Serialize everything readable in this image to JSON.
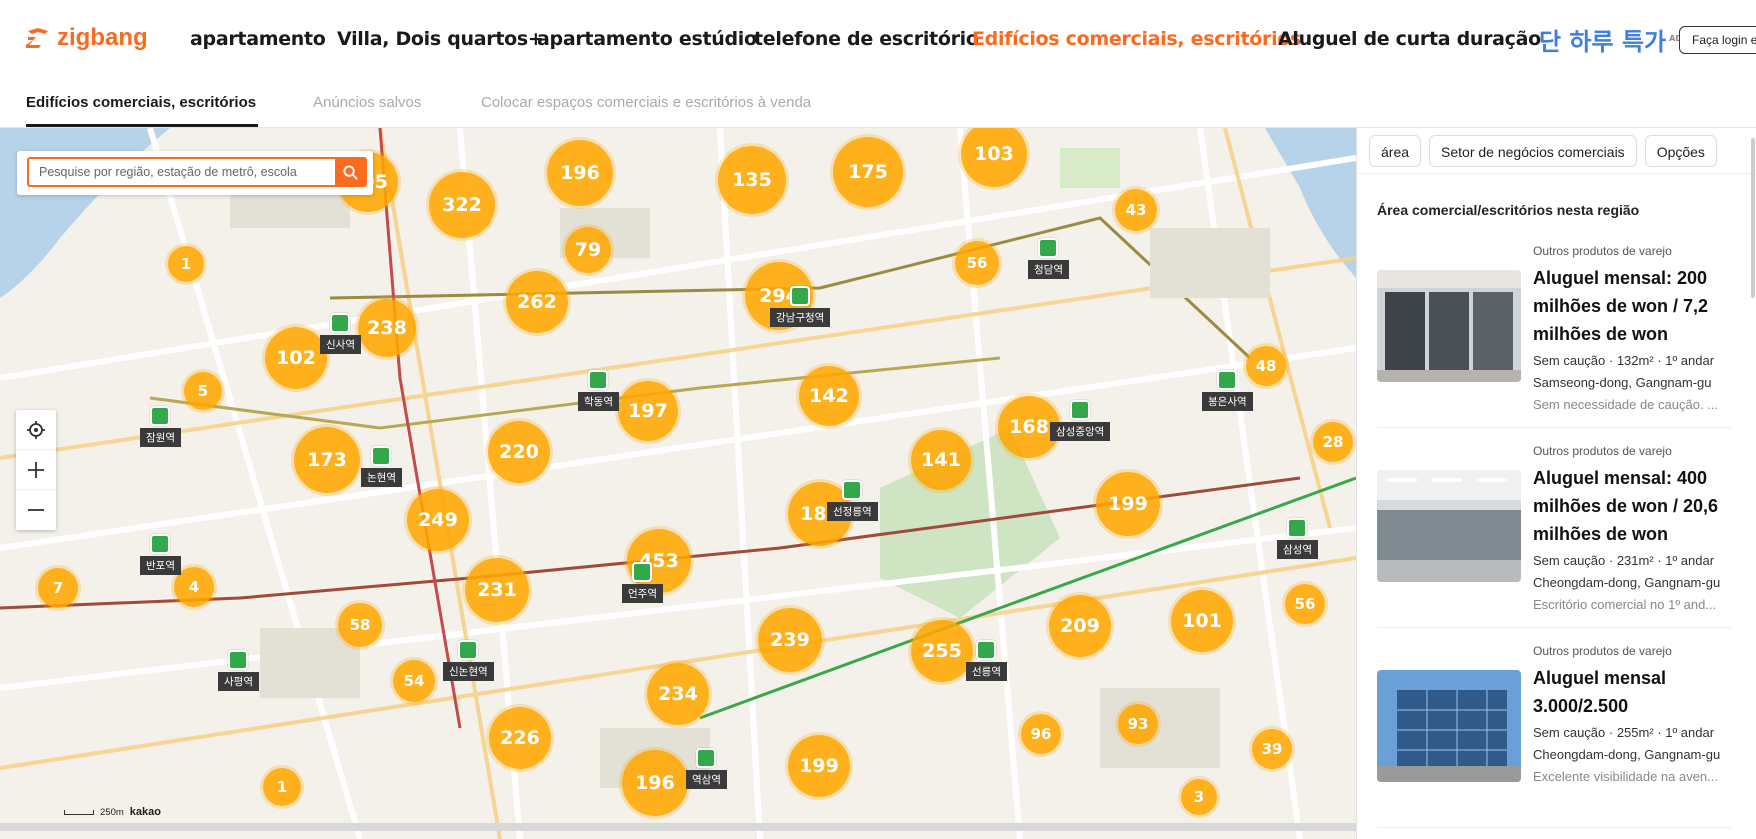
{
  "brand": {
    "name": "zigbang",
    "color": "#fa6b20"
  },
  "nav": {
    "items": [
      {
        "label": "apartamento",
        "active": false
      },
      {
        "label": "Villa, Dois quartos+",
        "active": false
      },
      {
        "label": "apartamento estúdio",
        "active": false
      },
      {
        "label": "telefone de escritório",
        "active": false
      },
      {
        "label": "Edifícios comerciais, escritórios",
        "active": true
      },
      {
        "label": "Aluguel de curta duração",
        "active": false
      }
    ],
    "promo": "단 하루 특가",
    "promo_badge": "AD",
    "login": "Faça login e"
  },
  "subtabs": [
    {
      "label": "Edifícios comerciais, escritórios",
      "active": true
    },
    {
      "label": "Anúncios salvos",
      "active": false
    },
    {
      "label": "Colocar espaços comerciais e escritórios à venda",
      "active": false
    }
  ],
  "search": {
    "placeholder": "Pesquise por região, estação de metrô, escola"
  },
  "map": {
    "icons": {
      "locate": "locate-icon",
      "zoom_in": "plus-icon",
      "zoom_out": "minus-icon"
    },
    "scale_label": "250m",
    "provider": "kakao",
    "clusters": [
      "305",
      "322",
      "196",
      "135",
      "175",
      "103",
      "43",
      "79",
      "56",
      "1",
      "262",
      "294",
      "238",
      "102",
      "5",
      "197",
      "142",
      "48",
      "168",
      "173",
      "220",
      "141",
      "28",
      "249",
      "182",
      "199",
      "453",
      "7",
      "4",
      "231",
      "58",
      "239",
      "255",
      "209",
      "101",
      "56",
      "54",
      "234",
      "226",
      "96",
      "93",
      "39",
      "1",
      "196",
      "199",
      "3"
    ],
    "stations": [
      "신사역",
      "강남구청역",
      "청담역",
      "학동역",
      "봉은사역",
      "잠원역",
      "논현역",
      "삼성중앙역",
      "선정릉역",
      "반포역",
      "언주역",
      "삼성역",
      "신논현역",
      "사평역",
      "선릉역",
      "역삼역"
    ]
  },
  "panel": {
    "filters": [
      "área",
      "Setor de negócios comerciais",
      "Opções"
    ],
    "title": "Área comercial/escritórios nesta região",
    "listings": [
      {
        "category": "Outros produtos de varejo",
        "title": "Aluguel mensal: 200 milhões de won / 7,2 milhões de won",
        "meta1": "Sem caução · 132m² · 1º andar",
        "meta2": "Samseong-dong, Gangnam-gu",
        "desc": "Sem necessidade de caução. ..."
      },
      {
        "category": "Outros produtos de varejo",
        "title": "Aluguel mensal: 400 milhões de won / 20,6 milhões de won",
        "meta1": "Sem caução · 231m² · 1º andar",
        "meta2": "Cheongdam-dong, Gangnam-gu",
        "desc": "Escritório comercial no 1º and..."
      },
      {
        "category": "Outros produtos de varejo",
        "title": "Aluguel mensal 3.000/2.500",
        "meta1": "Sem caução · 255m² · 1º andar",
        "meta2": "Cheongdam-dong, Gangnam-gu",
        "desc": "Excelente visibilidade na aven..."
      }
    ]
  }
}
